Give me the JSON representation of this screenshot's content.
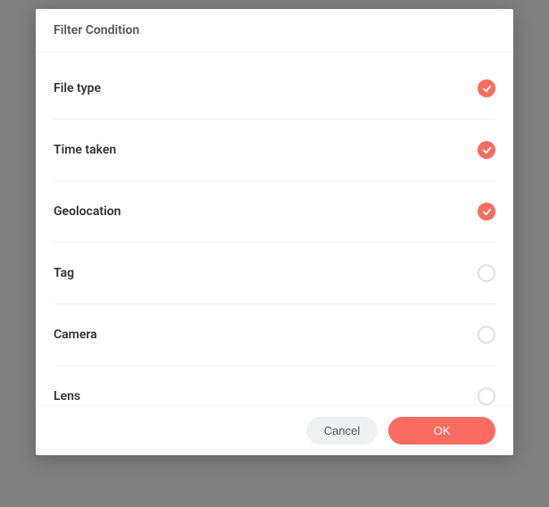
{
  "modal": {
    "title": "Filter Condition",
    "items": [
      {
        "label": "File type",
        "checked": true
      },
      {
        "label": "Time taken",
        "checked": true
      },
      {
        "label": "Geolocation",
        "checked": true
      },
      {
        "label": "Tag",
        "checked": false
      },
      {
        "label": "Camera",
        "checked": false
      },
      {
        "label": "Lens",
        "checked": false
      }
    ],
    "cancel_label": "Cancel",
    "ok_label": "OK"
  }
}
